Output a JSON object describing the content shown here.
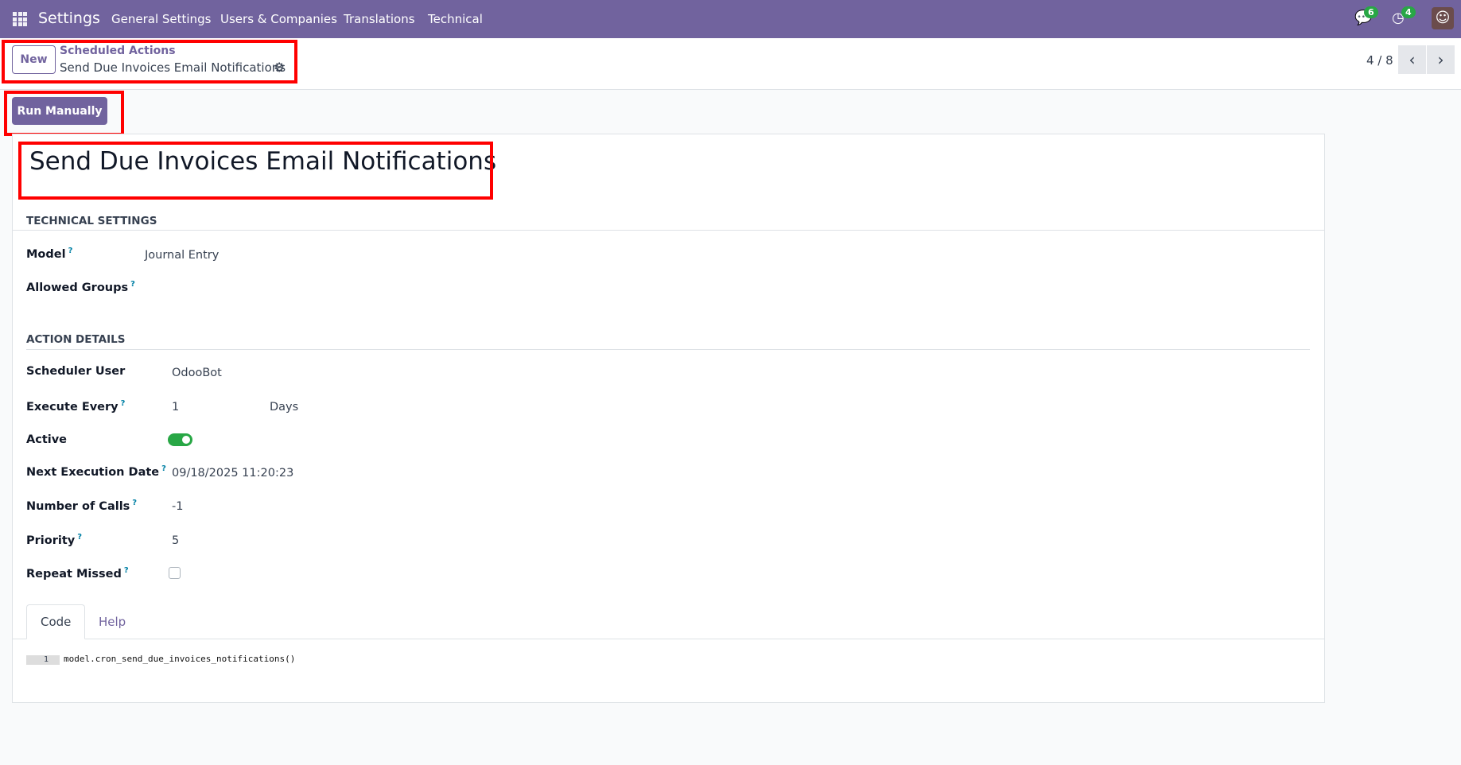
{
  "navbar": {
    "app": "Settings",
    "menu": [
      "General Settings",
      "Users & Companies",
      "Translations",
      "Technical"
    ],
    "messages_count": "6",
    "activities_count": "4"
  },
  "control_panel": {
    "new_label": "New",
    "breadcrumb_parent": "Scheduled Actions",
    "breadcrumb_current": "Send Due Invoices Email Notifications",
    "pager": "4 / 8"
  },
  "run_manually": "Run Manually",
  "record": {
    "title": "Send Due Invoices Email Notifications",
    "technical_settings": "TECHNICAL SETTINGS",
    "model_label": "Model",
    "model_value": "Journal Entry",
    "allowed_groups_label": "Allowed Groups",
    "action_details": "ACTION DETAILS",
    "scheduler_user_label": "Scheduler User",
    "scheduler_user_value": "OdooBot",
    "execute_every_label": "Execute Every",
    "execute_every_value": "1",
    "execute_every_unit": "Days",
    "active_label": "Active",
    "active": true,
    "next_execution_label": "Next Execution Date",
    "next_execution_value": "09/18/2025 11:20:23",
    "number_of_calls_label": "Number of Calls",
    "number_of_calls_value": "-1",
    "priority_label": "Priority",
    "priority_value": "5",
    "repeat_missed_label": "Repeat Missed",
    "repeat_missed": false,
    "help_mark": "?"
  },
  "tabs": [
    "Code",
    "Help"
  ],
  "code": {
    "line_number": "1",
    "line": "model.cron_send_due_invoices_notifications()"
  }
}
